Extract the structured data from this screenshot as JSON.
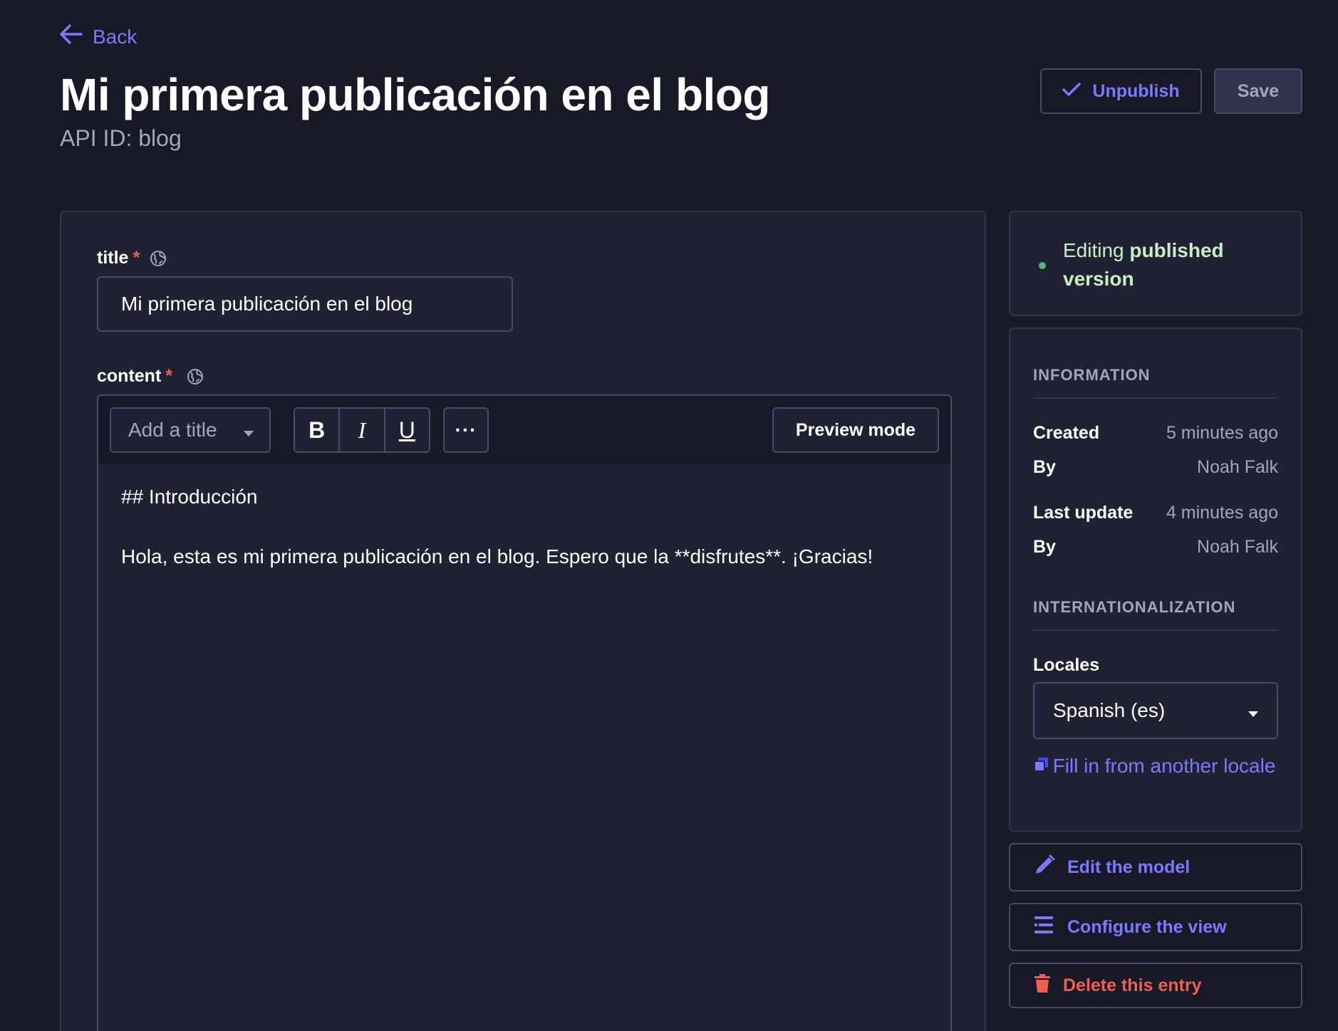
{
  "nav": {
    "back_label": "Back"
  },
  "header": {
    "title": "Mi primera publicación en el blog",
    "api_id": "API ID: blog",
    "unpublish_label": "Unpublish",
    "save_label": "Save"
  },
  "fields": {
    "title": {
      "label": "title",
      "required_mark": "*",
      "value": "Mi primera publicación en el blog"
    },
    "content": {
      "label": "content",
      "required_mark": "*"
    }
  },
  "editor": {
    "heading_placeholder": "Add a title",
    "bold_label": "B",
    "italic_label": "I",
    "underline_label": "U",
    "more_label": "···",
    "preview_label": "Preview mode",
    "lines": [
      "## Introducción",
      "Hola, esta es mi primera publicación en el blog. Espero que la **disfrutes**. ¡Gracias!"
    ]
  },
  "status": {
    "prefix": "Editing",
    "highlight": "published version"
  },
  "information": {
    "title": "INFORMATION",
    "rows": [
      {
        "key": "Created",
        "value": "5 minutes ago"
      },
      {
        "key": "By",
        "value": "Noah Falk"
      },
      {
        "key": "Last update",
        "value": "4 minutes ago"
      },
      {
        "key": "By",
        "value": "Noah Falk"
      }
    ]
  },
  "i18n": {
    "title": "INTERNATIONALIZATION",
    "locales_label": "Locales",
    "selected_locale": "Spanish (es)",
    "fill_label": "Fill in from another locale"
  },
  "actions": {
    "edit_model": "Edit the model",
    "configure_view": "Configure the view",
    "delete_entry": "Delete this entry"
  },
  "colors": {
    "background": "#181826",
    "panel": "#212134",
    "border": "#4a4a6a",
    "accent": "#7b79ff",
    "danger": "#ee5e52",
    "success": "#5cb176"
  }
}
